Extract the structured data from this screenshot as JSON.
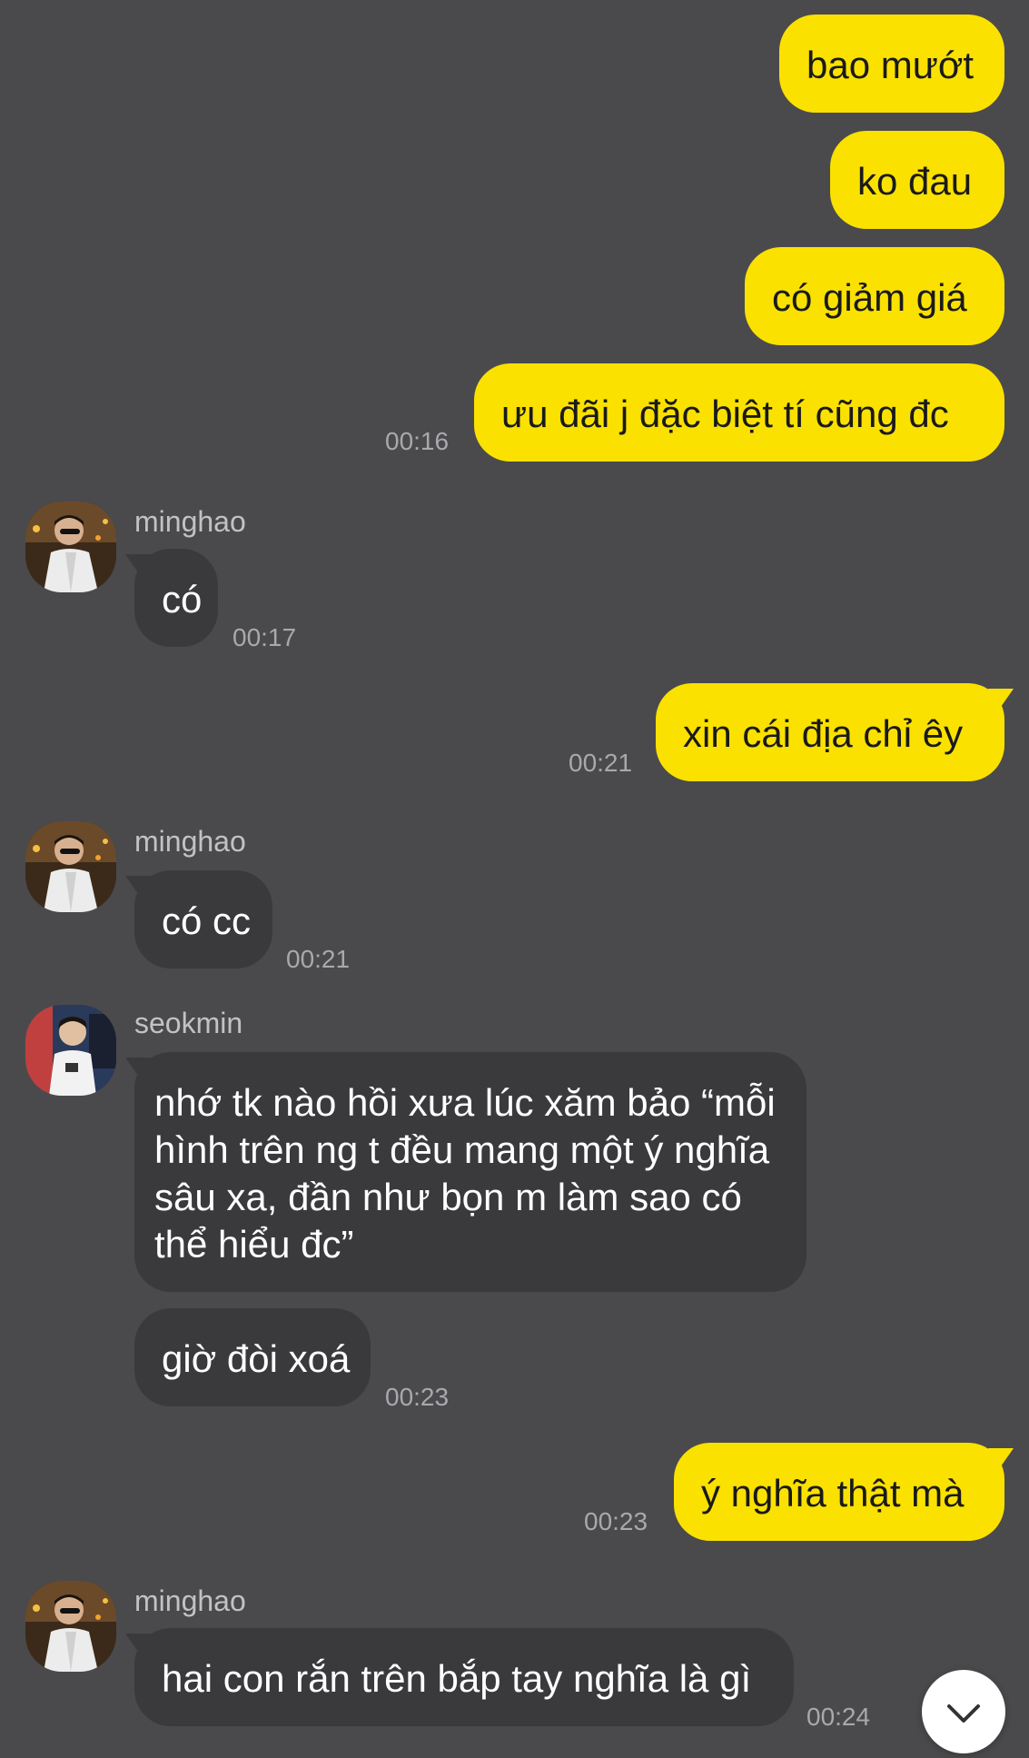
{
  "messages": {
    "m1": {
      "text": "bao mướt"
    },
    "m2": {
      "text": "ko đau"
    },
    "m3": {
      "text": "có giảm giá"
    },
    "m4": {
      "text": "ưu đãi j đặc biệt tí cũng đc",
      "time": "00:16"
    },
    "m5": {
      "sender": "minghao",
      "text": "có",
      "time": "00:17"
    },
    "m6": {
      "text": "xin cái địa chỉ êy",
      "time": "00:21"
    },
    "m7": {
      "sender": "minghao",
      "text": "có cc",
      "time": "00:21"
    },
    "m8": {
      "sender": "seokmin",
      "text": "nhớ tk nào hồi xưa lúc xăm bảo “mỗi hình trên ng t đều mang một ý nghĩa sâu xa, đần như bọn m làm sao có thể hiểu đc”"
    },
    "m9": {
      "text": "giờ đòi xoá",
      "time": "00:23"
    },
    "m10": {
      "text": "ý nghĩa thật mà",
      "time": "00:23"
    },
    "m11": {
      "sender": "minghao",
      "text": "hai con rắn trên bắp tay nghĩa là gì",
      "time": "00:24"
    }
  },
  "icons": {
    "avatar_minghao": "profile-photo",
    "avatar_seokmin": "profile-photo",
    "scroll_down": "chevron-down-icon"
  },
  "colors": {
    "background": "#4a4a4c",
    "outgoing_bubble": "#fae100",
    "incoming_bubble": "#3a3a3c"
  }
}
